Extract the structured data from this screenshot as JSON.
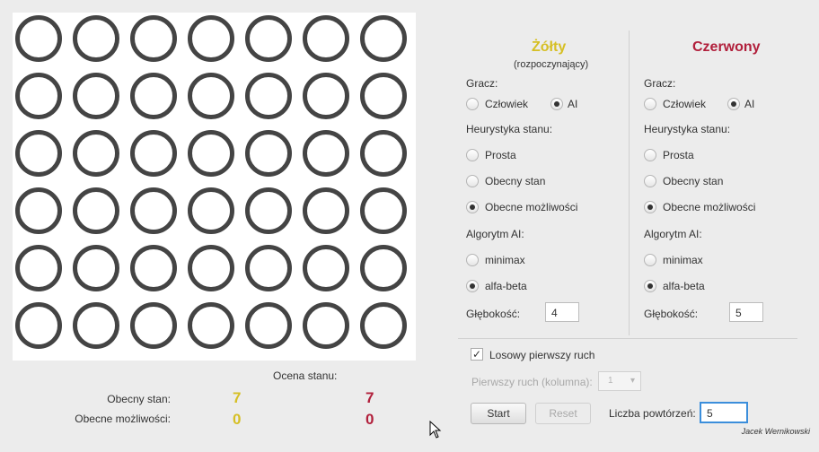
{
  "board": {
    "rows": 6,
    "cols": 7
  },
  "evaluation": {
    "title": "Ocena stanu:",
    "current_state_label": "Obecny stan:",
    "current_possibilities_label": "Obecne możliwości:",
    "yellow_state": "7",
    "red_state": "7",
    "yellow_possibilities": "0",
    "red_possibilities": "0"
  },
  "players": {
    "yellow": {
      "title": "Żółty",
      "subtitle": "(rozpoczynający)",
      "color": "#d6bf24",
      "player_label": "Gracz:",
      "human": "Człowiek",
      "ai": "AI",
      "heuristic_label": "Heurystyka stanu:",
      "h1": "Prosta",
      "h2": "Obecny stan",
      "h3": "Obecne możliwości",
      "algo_label": "Algorytm AI:",
      "a1": "minimax",
      "a2": "alfa-beta",
      "depth_label": "Głębokość:",
      "depth": "4"
    },
    "red": {
      "title": "Czerwony",
      "color": "#b11f3b",
      "player_label": "Gracz:",
      "human": "Człowiek",
      "ai": "AI",
      "heuristic_label": "Heurystyka stanu:",
      "h1": "Prosta",
      "h2": "Obecny stan",
      "h3": "Obecne możliwości",
      "algo_label": "Algorytm AI:",
      "a1": "minimax",
      "a2": "alfa-beta",
      "depth_label": "Głębokość:",
      "depth": "5"
    }
  },
  "controls": {
    "random_first_move": "Losowy pierwszy ruch",
    "first_move_label": "Pierwszy ruch (kolumna):",
    "first_move_value": "1",
    "start": "Start",
    "reset": "Reset",
    "repeats_label": "Liczba powtórzeń:",
    "repeats": "5"
  },
  "author": "Jacek Wernikowski"
}
